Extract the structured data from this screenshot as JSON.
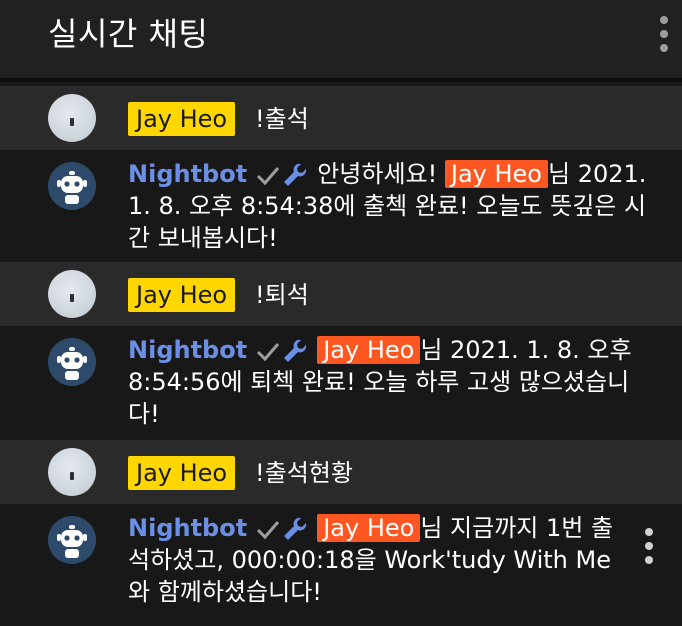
{
  "header": {
    "title": "실시간 채팅"
  },
  "messages": [
    {
      "type": "user",
      "author": "Jay Heo",
      "text": "!출석"
    },
    {
      "type": "bot",
      "author": "Nightbot",
      "pre": "안녕하세요! ",
      "mention": "Jay Heo",
      "post": "님 2021. 1. 8. 오후 8:54:38에 출첵 완료! 오늘도 뜻깊은 시간 보내봅시다!"
    },
    {
      "type": "user",
      "author": "Jay Heo",
      "text": "!퇴석"
    },
    {
      "type": "bot",
      "author": "Nightbot",
      "pre": "",
      "mention": "Jay Heo",
      "post": "님 2021. 1. 8. 오후 8:54:56에 퇴첵 완료! 오늘 하루 고생 많으셨습니다!"
    },
    {
      "type": "user",
      "author": "Jay Heo",
      "text": "!출석현황"
    },
    {
      "type": "bot",
      "author": "Nightbot",
      "pre": "",
      "mention": "Jay Heo",
      "post": "님 지금까지 1번 출석하셨고, 000:00:18을 Work'tudy With Me와 함께하셨습니다!"
    }
  ],
  "colors": {
    "author_badge": "#ffd600",
    "mention": "#ff5722",
    "bot_name": "#6c8fe6"
  },
  "icons": {
    "verified": "checkmark-icon",
    "moderator": "wrench-icon",
    "menu": "more-vert-icon"
  }
}
